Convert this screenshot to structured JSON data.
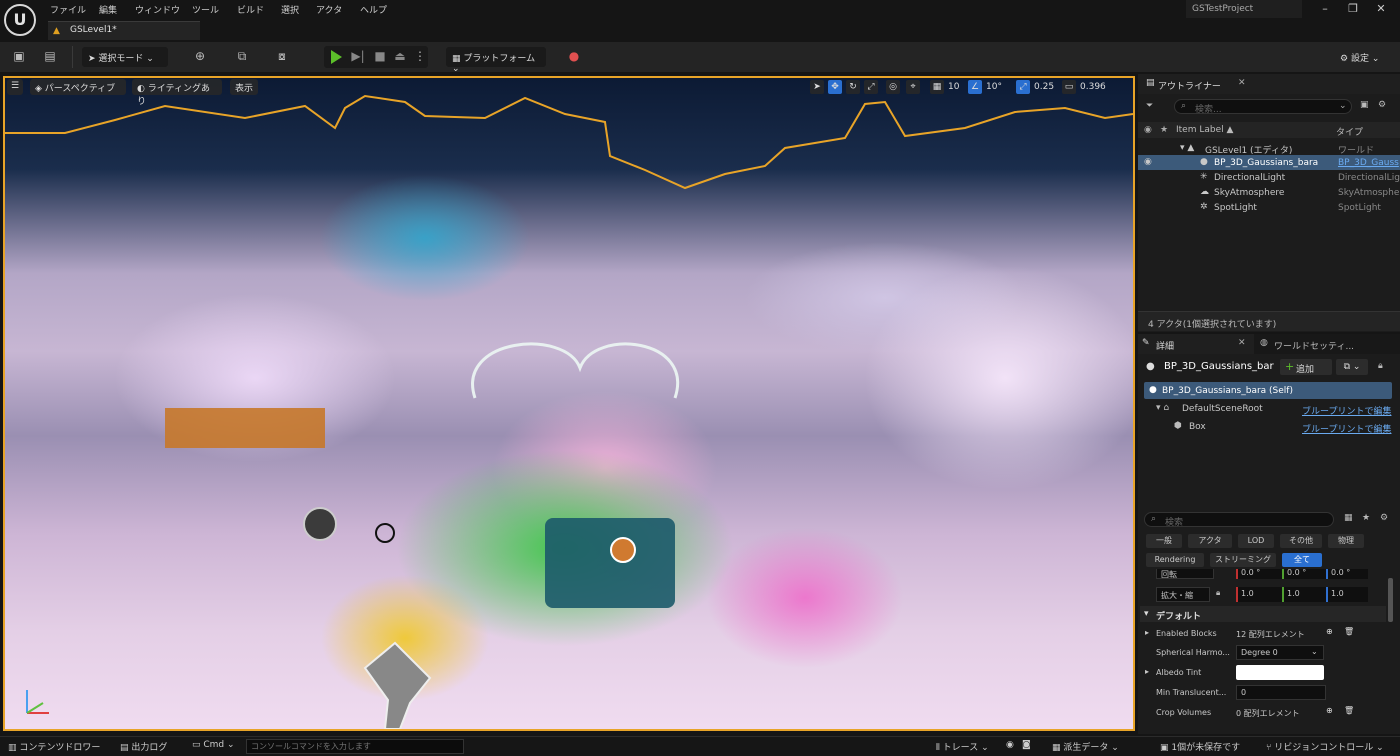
{
  "menu": [
    "ファイル",
    "編集",
    "ウィンドウ",
    "ツール",
    "ビルド",
    "選択",
    "アクタ",
    "ヘルプ"
  ],
  "project_name": "GSTestProject",
  "level_tab": "GSLevel1*",
  "toolbar": {
    "select_mode": "選択モード",
    "platform": "プラットフォーム",
    "settings": "設定"
  },
  "viewport": {
    "perspective": "パースペクティブ",
    "lighting": "ライティングあり",
    "show": "表示",
    "grid_size": "10",
    "rotation_snap": "10°",
    "scale_snap": "0.25",
    "camera_speed": "0.396"
  },
  "outliner": {
    "title": "アウトライナー",
    "search_placeholder": "検索...",
    "col_label": "Item Label ▲",
    "col_type": "タイプ",
    "rows": [
      {
        "label": "GSLevel1 (エディタ)",
        "type": "ワールド"
      },
      {
        "label": "BP_3D_Gaussians_bara",
        "type": "BP_3D_Gauss"
      },
      {
        "label": "DirectionalLight",
        "type": "DirectionalLig"
      },
      {
        "label": "SkyAtmosphere",
        "type": "SkyAtmosphe"
      },
      {
        "label": "SpotLight",
        "type": "SpotLight"
      }
    ],
    "status": "4 アクタ(1個選択されています)"
  },
  "details": {
    "tab_details": "詳細",
    "tab_world": "ワールドセッティ...",
    "actor_name": "BP_3D_Gaussians_bar",
    "add_button": "追加",
    "components": [
      {
        "label": "BP_3D_Gaussians_bara (Self)",
        "link": ""
      },
      {
        "label": "DefaultSceneRoot",
        "link": "ブループリントで編集"
      },
      {
        "label": "Box",
        "link": "ブループリントで編集"
      }
    ],
    "search_placeholder": "検索",
    "filters_row1": [
      "一般",
      "アクタ",
      "LOD",
      "その他",
      "物理"
    ],
    "filters_row2": [
      "Rendering",
      "ストリーミング",
      "全て"
    ],
    "rotation_label": "回転",
    "rotation_values": [
      "0.0 °",
      "0.0 °",
      "0.0 °"
    ],
    "scale_label": "拡大・縮",
    "scale_values": [
      "1.0",
      "1.0",
      "1.0"
    ],
    "section": "デフォルト",
    "props": [
      {
        "label": "Enabled Blocks",
        "value": "12 配列エレメント"
      },
      {
        "label": "Spherical Harmo...",
        "value": "Degree 0"
      },
      {
        "label": "Albedo Tint",
        "value": ""
      },
      {
        "label": "Min Translucent...",
        "value": "0"
      },
      {
        "label": "Crop Volumes",
        "value": "0 配列エレメント"
      }
    ]
  },
  "bottombar": {
    "content_drawer": "コンテンツドロワー",
    "output_log": "出力ログ",
    "cmd": "Cmd",
    "console_placeholder": "コンソールコマンドを入力します",
    "trace": "トレース",
    "derived_data": "派生データ",
    "unsaved": "1個が未保存です",
    "revision_control": "リビジョンコントロール"
  }
}
